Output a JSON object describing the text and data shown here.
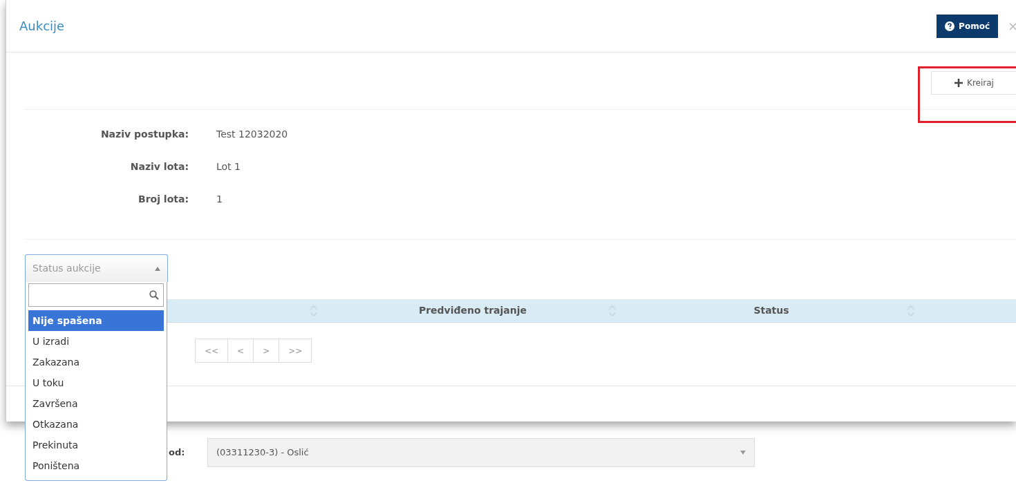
{
  "header": {
    "title": "Aukcije",
    "help_button": "Pomoć",
    "close_button": "×"
  },
  "toolbar": {
    "create_button": "Kreiraj",
    "highlighted": true
  },
  "details": [
    {
      "label": "Naziv postupka:",
      "value": "Test 12032020"
    },
    {
      "label": "Naziv lota:",
      "value": "Lot 1"
    },
    {
      "label": "Broj lota:",
      "value": "1"
    }
  ],
  "status_filter": {
    "placeholder": "Status aukcije",
    "expanded": true,
    "options": [
      {
        "label": "Nije spašena",
        "selected": true
      },
      {
        "label": "U izradi",
        "selected": false
      },
      {
        "label": "Zakazana",
        "selected": false
      },
      {
        "label": "U toku",
        "selected": false
      },
      {
        "label": "Završena",
        "selected": false
      },
      {
        "label": "Otkazana",
        "selected": false
      },
      {
        "label": "Prekinuta",
        "selected": false
      },
      {
        "label": "Poništena",
        "selected": false
      }
    ]
  },
  "table": {
    "columns": [
      {
        "sortable": true
      },
      {
        "label": "Predviđeno trajanje",
        "sortable": true
      },
      {
        "label": "Status",
        "sortable": true
      }
    ]
  },
  "pagination": [
    "<<",
    "<",
    ">",
    ">>"
  ],
  "background_form": {
    "label": "od:",
    "select_value": "(03311230-3) - Oslić"
  }
}
